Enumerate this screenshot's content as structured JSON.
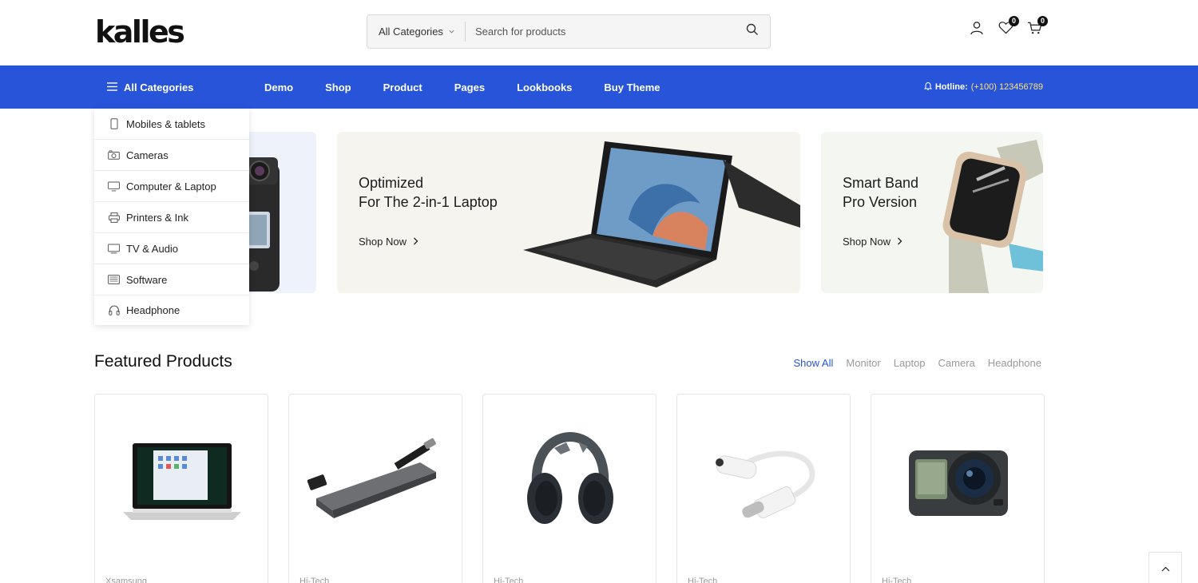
{
  "header": {
    "logo": "kalles",
    "search_category": "All Categories",
    "search_placeholder": "Search for products",
    "wishlist_count": "0",
    "cart_count": "0"
  },
  "nav": {
    "all_categories": "All Categories",
    "links": [
      "Demo",
      "Shop",
      "Product",
      "Pages",
      "Lookbooks",
      "Buy Theme"
    ],
    "hotline_label": "Hotline:",
    "hotline_number": "(+100) 123456789"
  },
  "dropdown": {
    "items": [
      {
        "label": "Mobiles & tablets",
        "icon": "mobile-icon"
      },
      {
        "label": "Cameras",
        "icon": "camera-icon"
      },
      {
        "label": "Computer & Laptop",
        "icon": "monitor-icon"
      },
      {
        "label": "Printers & Ink",
        "icon": "printer-icon"
      },
      {
        "label": "TV & Audio",
        "icon": "tv-icon"
      },
      {
        "label": "Software",
        "icon": "software-icon"
      },
      {
        "label": "Headphone",
        "icon": "headphone-icon"
      }
    ]
  },
  "banners": {
    "mid": {
      "title_line1": "Optimized",
      "title_line2": "For The 2-in-1 Laptop",
      "cta": "Shop Now"
    },
    "right": {
      "title_line1": "Smart Band",
      "title_line2": "Pro Version",
      "cta": "Shop Now"
    }
  },
  "featured": {
    "title": "Featured Products",
    "tabs": [
      "Show All",
      "Monitor",
      "Laptop",
      "Camera",
      "Headphone"
    ],
    "products": [
      {
        "brand": "Xsamsung",
        "image": "laptop"
      },
      {
        "brand": "Hi-Tech",
        "image": "usb-hub"
      },
      {
        "brand": "Hi-Tech",
        "image": "headphones"
      },
      {
        "brand": "Hi-Tech",
        "image": "audio-adapter"
      },
      {
        "brand": "Hi-Tech",
        "image": "action-camera"
      }
    ]
  },
  "colors": {
    "brand_blue": "#2754d8",
    "hotline_yellow": "#ffe27a"
  }
}
